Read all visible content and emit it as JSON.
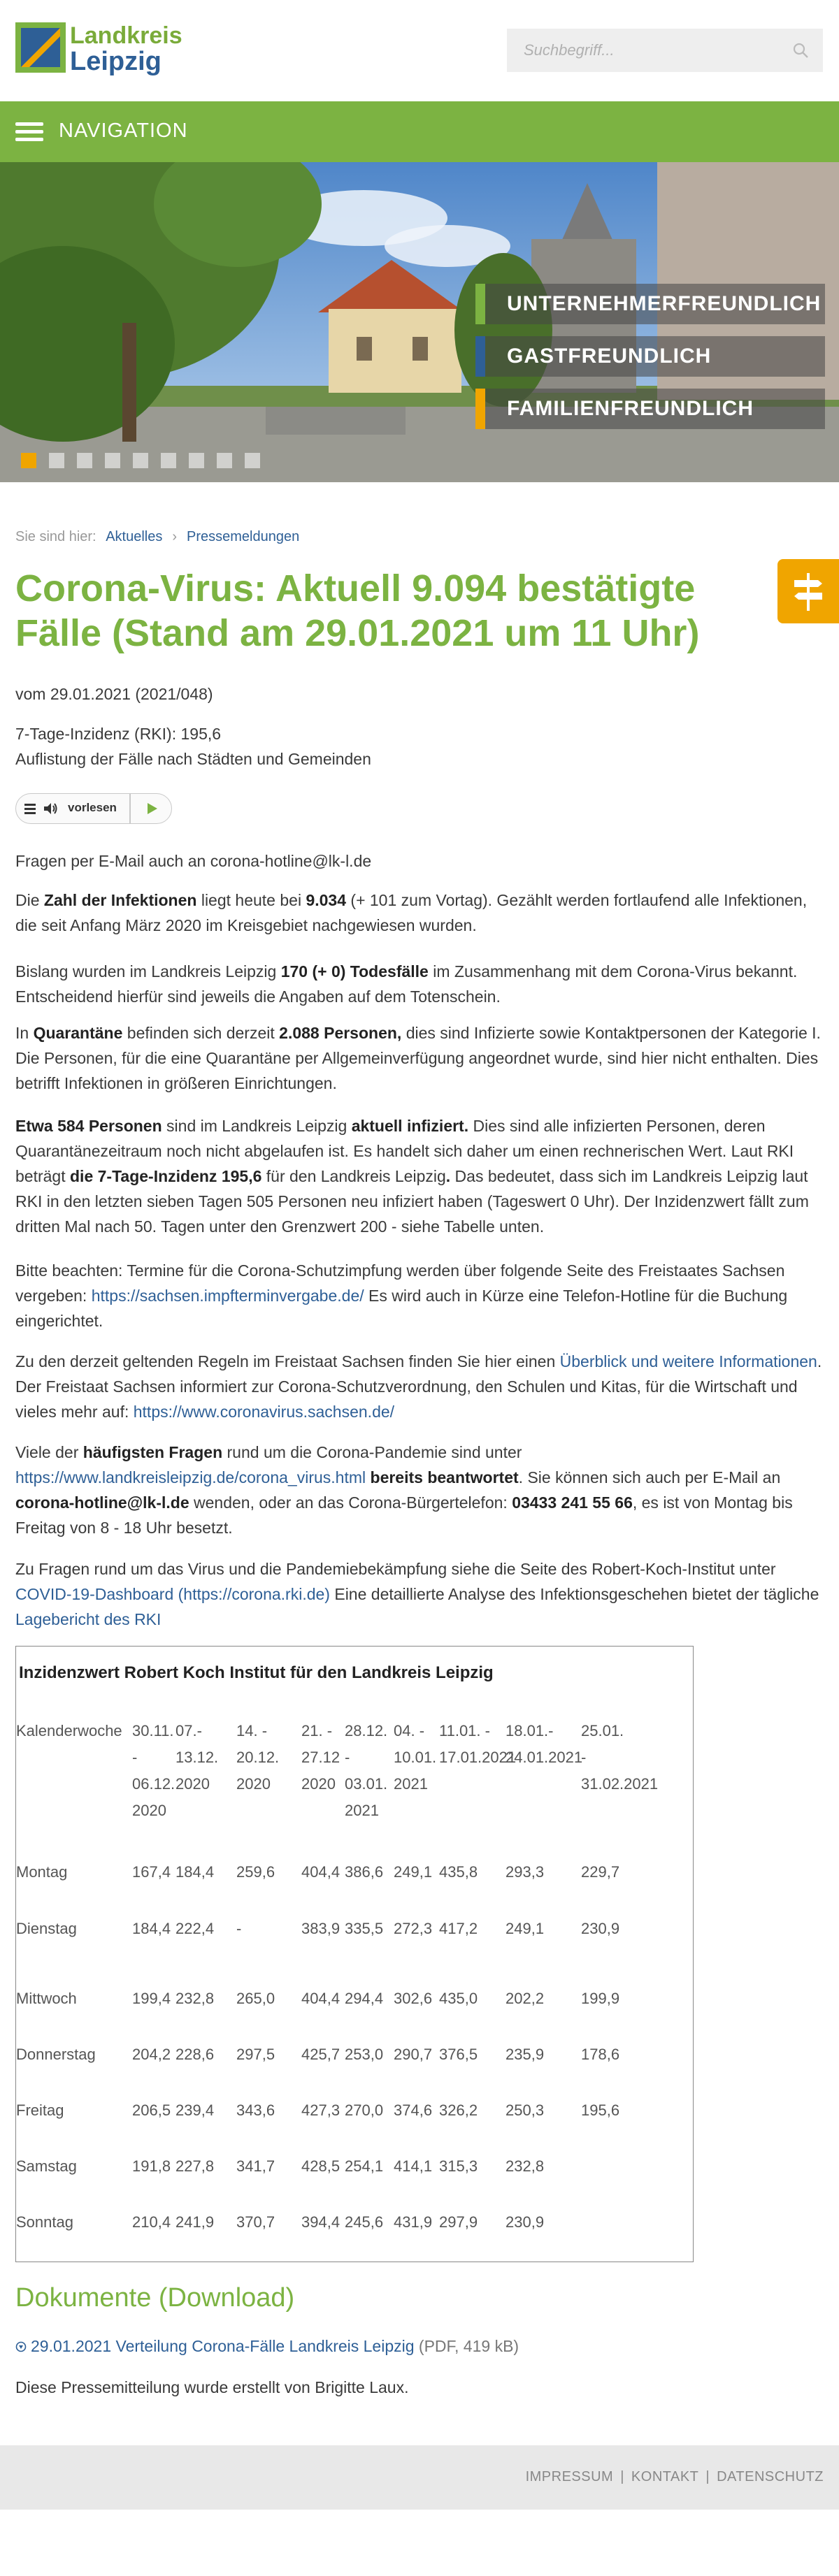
{
  "header": {
    "logo_line1": "Landkreis",
    "logo_line2": "Leipzig",
    "search_placeholder": "Suchbegriff..."
  },
  "nav": {
    "label": "NAVIGATION"
  },
  "hero": {
    "taglines": [
      "UNTERNEHMERFREUNDLICH",
      "GASTFREUNDLICH",
      "FAMILIENFREUNDLICH"
    ],
    "tagline_colors": [
      "#7cb342",
      "#2e5f96",
      "#f0a500"
    ],
    "slides": 6
  },
  "breadcrumb": {
    "prefix": "Sie sind hier:",
    "items": [
      "Aktuelles",
      "Pressemeldungen"
    ],
    "separator": "›"
  },
  "article": {
    "title": "Corona-Virus: Aktuell 9.094 bestätigte Fälle (Stand am 29.01.2021 um 11 Uhr)",
    "date": "vom 29.01.2021 (2021/048)",
    "incidence_line": "7-Tage-Inzidenz (RKI): 195,6",
    "list_line": "Auflistung der Fälle nach Städten und Gemeinden",
    "reader_label": "vorlesen",
    "email_question": "Fragen per E-Mail auch an corona-hotline@lk-l.de",
    "p1": {
      "a": "Die ",
      "b1": "Zahl der Infektionen",
      "c": " liegt heute bei ",
      "b2": "9.034",
      "d": " (+ 101 zum Vortag). Gezählt werden fortlaufend alle Infektionen, die seit Anfang März 2020 im Kreisgebiet nachgewiesen wurden."
    },
    "p2": {
      "a": "Bislang wurden im Landkreis Leipzig ",
      "b": "170 (+ 0) Todesfälle",
      "c": " im Zusammenhang mit dem Corona-Virus bekannt. Entscheidend hierfür sind jeweils die Angaben auf dem Totenschein."
    },
    "p3": {
      "a": "In ",
      "b1": "Quarantäne",
      "c": " befinden sich derzeit ",
      "b2": "2.088 Personen,",
      "d": " dies sind Infizierte sowie Kontaktpersonen der Kategorie I. Die Personen, für die eine Quarantäne per Allgemeinverfügung  angeordnet wurde, sind hier nicht enthalten. Dies betrifft Infektionen in größeren Einrichtungen."
    },
    "p4": {
      "b1": "Etwa 584 Personen",
      "a": " sind im Landkreis Leipzig ",
      "b2": "aktuell infiziert.",
      "c": " Dies sind alle infizierten Personen, deren Quarantänezeitraum noch nicht abgelaufen ist. Es handelt sich daher um einen rechnerischen Wert. Laut RKI beträgt ",
      "b3": "die 7-Tage-Inzidenz 195,6",
      "d": " für den Landkreis Leipzig",
      "b4": ".",
      "e": " Das bedeutet, dass sich im Landkreis Leipzig laut RKI in den letzten sieben Tagen 505 Personen neu infiziert haben (Tageswert 0 Uhr). Der Inzidenzwert fällt zum dritten Mal nach 50. Tagen unter den Grenzwert 200 - siehe Tabelle unten."
    },
    "p5": {
      "a": "Bitte beachten: Termine für die Corona-Schutzimpfung werden über folgende Seite des Freistaates Sachsen vergeben: ",
      "link": "https://sachsen.impfterminvergabe.de/",
      "b": "  Es wird auch in Kürze eine Telefon-Hotline für die Buchung eingerichtet."
    },
    "p6": {
      "a": "Zu den derzeit geltenden Regeln im Freistaat Sachsen finden Sie hier einen ",
      "link1": "Überblick und weitere Informationen",
      "b": ". Der Freistaat Sachsen informiert zur Corona-Schutzverordnung, den Schulen und Kitas, für die Wirtschaft und vieles mehr auf: ",
      "link2": "https://www.coronavirus.sachsen.de/"
    },
    "p7": {
      "a": "Viele der ",
      "b1": "häufigsten Fragen",
      "c": " rund um die Corona-Pandemie sind unter ",
      "link": "https://www.landkreisleipzig.de/corona_virus.html",
      "b2": " bereits beantwortet",
      "d": ". Sie können sich auch per E-Mail an ",
      "b3": "corona-hotline@lk-l.de",
      "e": " wenden, oder an das Corona-Bürgertelefon: ",
      "b4": "03433 241 55 66",
      "f": ", es ist von Montag bis Freitag von 8 - 18 Uhr besetzt."
    },
    "p8": {
      "a": "Zu Fragen rund um das Virus und die Pandemiebekämpfung siehe die Seite des Robert-Koch-Institut unter ",
      "link1": "COVID-19-Dashboard (https://corona.rki.de)",
      "b": "  Eine detaillierte Analyse des Infektionsgeschehen bietet der tägliche ",
      "link2": "Lagebericht des RKI"
    }
  },
  "table": {
    "title": "Inzidenzwert Robert Koch Institut für den Landkreis Leipzig",
    "header_label": "Kalenderwoche",
    "columns": [
      [
        "30.11.",
        "-",
        "06.12.",
        "2020"
      ],
      [
        "07.-",
        "13.12.",
        "2020"
      ],
      [
        "14. -",
        "20.12.",
        "2020"
      ],
      [
        "21. -",
        "27.12",
        "2020"
      ],
      [
        "28.12.",
        "-",
        "03.01.",
        "2021"
      ],
      [
        "04. -",
        "10.01.",
        "2021"
      ],
      [
        "11.01. -",
        "17.01.2021"
      ],
      [
        "18.01.-",
        "24.01.2021"
      ],
      [
        "25.01.",
        "-",
        "31.02.2021"
      ]
    ],
    "rows": [
      {
        "day": "Montag",
        "values": [
          "167,4",
          "184,4",
          "259,6",
          "404,4",
          "386,6",
          "249,1",
          "435,8",
          "293,3",
          "229,7"
        ]
      },
      {
        "day": "Dienstag",
        "values": [
          "184,4",
          "222,4",
          "-",
          "383,9",
          "335,5",
          "272,3",
          "417,2",
          "249,1",
          "230,9"
        ]
      },
      {
        "day": "Mittwoch",
        "values": [
          "199,4",
          "232,8",
          "265,0",
          "404,4",
          "294,4",
          "302,6",
          "435,0",
          "202,2",
          "199,9"
        ]
      },
      {
        "day": "Donnerstag",
        "values": [
          "204,2",
          "228,6",
          "297,5",
          "425,7",
          "253,0",
          "290,7",
          "376,5",
          "235,9",
          "178,6"
        ]
      },
      {
        "day": "Freitag",
        "values": [
          "206,5",
          "239,4",
          "343,6",
          "427,3",
          "270,0",
          "374,6",
          "326,2",
          "250,3",
          "195,6"
        ]
      },
      {
        "day": "Samstag",
        "values": [
          "191,8",
          "227,8",
          "341,7",
          "428,5",
          "254,1",
          "414,1",
          "315,3",
          "232,8",
          ""
        ]
      },
      {
        "day": "Sonntag",
        "values": [
          "210,4",
          "241,9",
          "370,7",
          "394,4",
          "245,6",
          "431,9",
          "297,9",
          "230,9",
          ""
        ]
      }
    ]
  },
  "documents": {
    "title": "Dokumente (Download)",
    "link": "29.01.2021 Verteilung Corona-Fälle Landkreis Leipzig",
    "meta": "(PDF, 419 kB)",
    "author_note": "Diese Pressemitteilung wurde erstellt von Brigitte Laux."
  },
  "footer": {
    "links": [
      "IMPRESSUM",
      "KONTAKT",
      "DATENSCHUTZ"
    ],
    "separator": "|"
  }
}
